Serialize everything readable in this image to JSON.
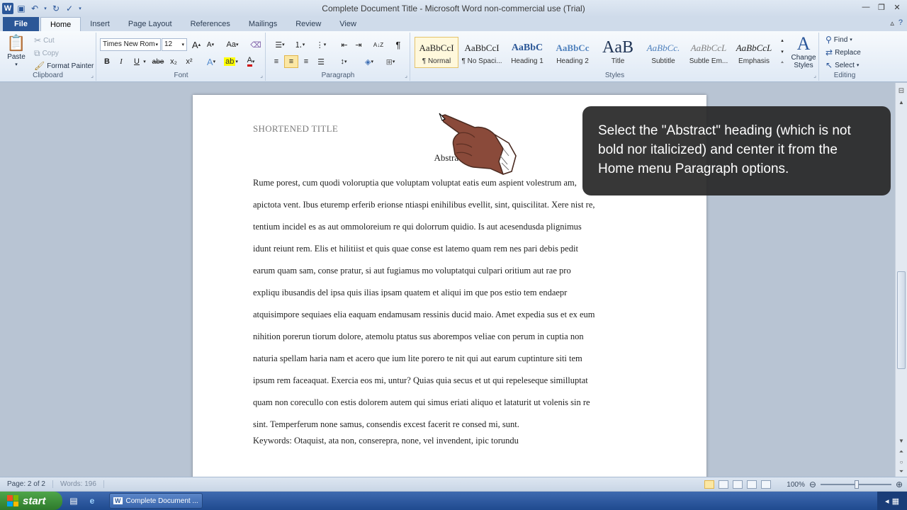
{
  "window": {
    "title": "Complete Document Title  -  Microsoft Word non-commercial use (Trial)"
  },
  "tabs": [
    "File",
    "Home",
    "Insert",
    "Page Layout",
    "References",
    "Mailings",
    "Review",
    "View"
  ],
  "ribbon": {
    "clipboard": {
      "label": "Clipboard",
      "paste": "Paste",
      "cut": "Cut",
      "copy": "Copy",
      "format_painter": "Format Painter"
    },
    "font": {
      "label": "Font",
      "family": "Times New Rom",
      "size": "12",
      "bold": "B",
      "italic": "I",
      "underline": "U",
      "strike": "abe",
      "subscript": "x₂",
      "superscript": "x²",
      "change_case": "Aa",
      "grow": "A",
      "shrink": "A"
    },
    "paragraph": {
      "label": "Paragraph",
      "sort": "A↓Z",
      "pilcrow": "¶"
    },
    "styles": {
      "label": "Styles",
      "items": [
        {
          "sample": "AaBbCcI",
          "name": "¶ Normal"
        },
        {
          "sample": "AaBbCcI",
          "name": "¶ No Spaci..."
        },
        {
          "sample": "AaBbC",
          "name": "Heading 1"
        },
        {
          "sample": "AaBbCc",
          "name": "Heading 2"
        },
        {
          "sample": "AaB",
          "name": "Title"
        },
        {
          "sample": "AaBbCc.",
          "name": "Subtitle"
        },
        {
          "sample": "AaBbCcL",
          "name": "Subtle Em..."
        },
        {
          "sample": "AaBbCcL",
          "name": "Emphasis"
        }
      ],
      "change_styles": "Change Styles"
    },
    "editing": {
      "label": "Editing",
      "find": "Find",
      "replace": "Replace",
      "select": "Select"
    }
  },
  "document": {
    "short_title": "SHORTENED TITLE",
    "heading": "Abstract",
    "lines": [
      "Rume porest, cum quodi voloruptia que voluptam voluptat eatis eum aspient volestrum am,",
      "apictota vent. Ibus eturemp erferib erionse ntiaspi enihilibus evellit, sint, quiscilitat. Xere nist re,",
      "tentium incidel es as aut ommoloreium re qui dolorrum quidio. Is aut acesendusda plignimus",
      "idunt reiunt rem. Elis et hilitiist et quis quae conse est latemo quam rem nes pari debis pedit",
      "earum quam sam, conse pratur, si aut fugiamus mo voluptatqui culpari oritium aut rae pro",
      "expliqu ibusandis del ipsa quis ilias ipsam quatem et aliqui im que pos estio tem endaepr",
      "atquisimpore sequiaes elia eaquam endamusam ressinis ducid maio. Amet expedia sus et ex eum",
      "nihition porerun tiorum dolore, atemolu ptatus sus aborempos veliae con perum in cuptia non",
      "naturia spellam haria nam et acero que ium lite porero te nit qui aut earum cuptinture siti tem",
      "ipsum rem faceaquat. Exercia eos mi, untur? Quias quia secus et ut qui repeleseque similluptat",
      "quam non corecullo con estis dolorem autem qui simus eriati aliquo et lataturit ut volenis sin re",
      "sint. Temperferum none samus, consendis excest facerit re consed mi, sunt."
    ],
    "keywords": "Keywords: Otaquist, ata non, conserepra, none, vel invendent, ipic torundu"
  },
  "callout": {
    "text": "Select the \"Abstract\" heading (which is not bold nor italicized) and center it from the Home menu Paragraph options."
  },
  "status": {
    "page": "Page: 2 of 2",
    "words": "Words: 196",
    "zoom": "100%"
  },
  "taskbar": {
    "start": "start",
    "task": "Complete Document ..."
  }
}
